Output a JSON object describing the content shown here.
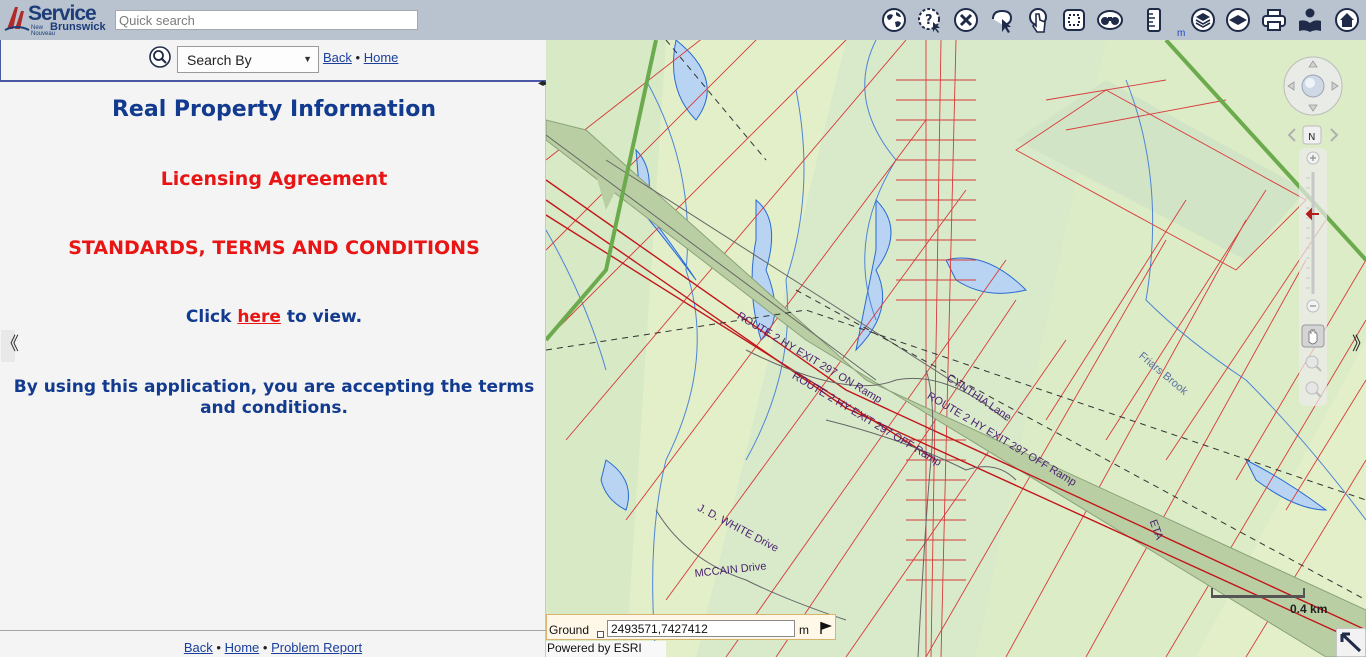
{
  "header": {
    "logo": {
      "service": "Service",
      "new": "New\nNouveau",
      "brunswick": "Brunswick"
    },
    "quick_search": {
      "placeholder": "Quick search",
      "value": ""
    },
    "tools": [
      {
        "name": "globe-icon",
        "label": "Map views"
      },
      {
        "name": "help-cursor-icon",
        "label": "Identify"
      },
      {
        "name": "clear-icon",
        "label": "Clear"
      },
      {
        "name": "select-icon",
        "label": "Select"
      },
      {
        "name": "touch-icon",
        "label": "Touch select"
      },
      {
        "name": "full-extent-icon",
        "label": "Full extent"
      },
      {
        "name": "binoculars-icon",
        "label": "Find"
      },
      {
        "name": "ruler-icon",
        "label": "Measure"
      },
      {
        "name": "layers-icon",
        "label": "Layers"
      },
      {
        "name": "basemap-icon",
        "label": "Basemap"
      },
      {
        "name": "print-icon",
        "label": "Print"
      },
      {
        "name": "reader-icon",
        "label": "Help"
      },
      {
        "name": "home-icon",
        "label": "Home"
      }
    ],
    "unit_label": "m"
  },
  "left_panel": {
    "search_by": "Search By",
    "nav": {
      "back": "Back",
      "separator": "•",
      "home": "Home"
    },
    "title": "Real Property Information",
    "licensing": "Licensing Agreement",
    "standards": "STANDARDS, TERMS AND CONDITIONS",
    "click_prefix": "Click",
    "click_link": "here",
    "click_suffix": "to view.",
    "accept_text": "By using this application, you are accepting the terms and conditions.",
    "footer": {
      "back": "Back",
      "home": "Home",
      "problem": "Problem Report",
      "separator": "•"
    }
  },
  "map": {
    "labels": [
      {
        "text": "ROUTE 2 HY EXIT 297 ON Ramp"
      },
      {
        "text": "ROUTE 2 HY EXIT 297 OFF Ramp"
      },
      {
        "text": "ROUTE 2 HY EXIT 297 OFF Ramp"
      },
      {
        "text": "CYNTHIA Lane"
      },
      {
        "text": "Friars Brook"
      },
      {
        "text": "J. D. WHITE Drive"
      },
      {
        "text": "MCCAIN Drive"
      },
      {
        "text": "ETA"
      }
    ],
    "scale_label": "0.4 km",
    "compass_label": "N",
    "coord": {
      "label": "Ground",
      "value": "2493571,7427412",
      "unit": "m"
    },
    "powered_by": "Powered by ESRI"
  },
  "colors": {
    "toolbar_bg": "#b8c3cf",
    "title_blue": "#123b8f",
    "alert_red": "#e91414",
    "map_green": "#e0f0c6",
    "parcel_red": "#d83a3a"
  }
}
